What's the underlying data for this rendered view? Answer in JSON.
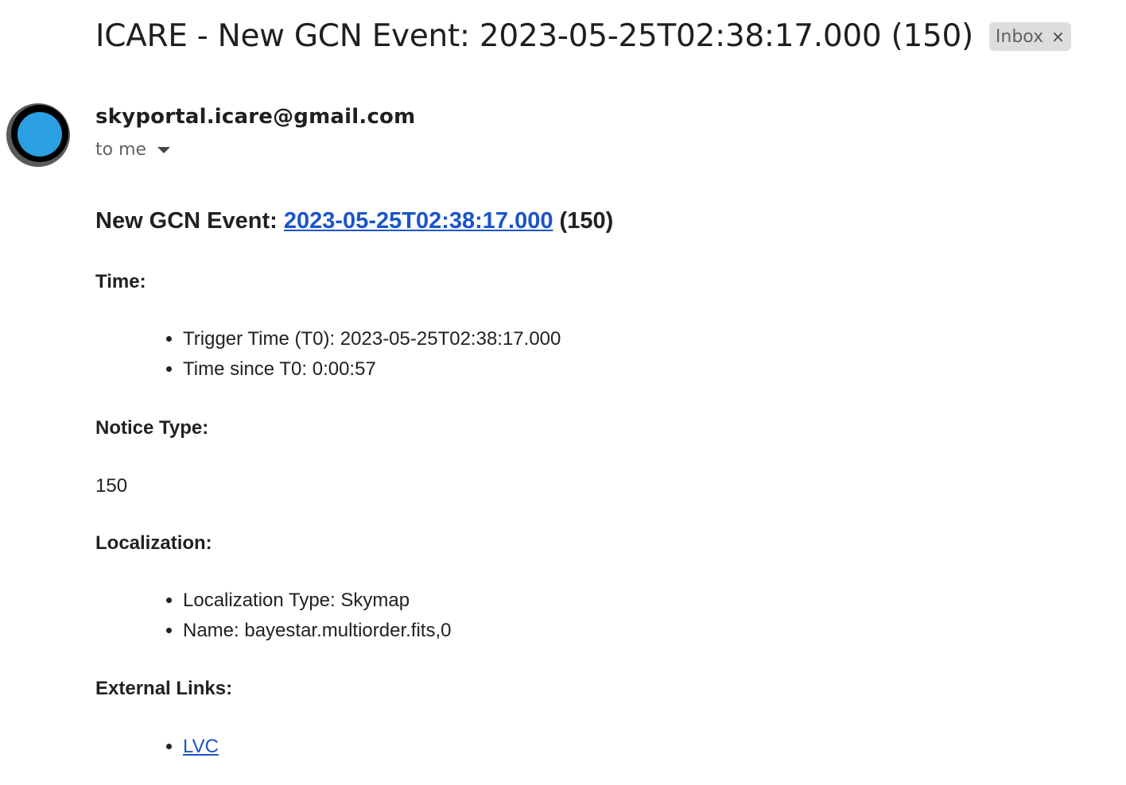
{
  "email": {
    "subject": "ICARE - New GCN Event: 2023-05-25T02:38:17.000 (150)",
    "label_chip": "Inbox",
    "label_remove_icon": "×",
    "sender": "skyportal.icare@gmail.com",
    "recipients": "to me"
  },
  "body": {
    "heading_prefix": "New GCN Event:",
    "heading_link": "2023-05-25T02:38:17.000",
    "heading_suffix": "(150)",
    "time_label": "Time:",
    "time_items": [
      "Trigger Time (T0): 2023-05-25T02:38:17.000",
      "Time since T0: 0:00:57"
    ],
    "notice_label": "Notice Type:",
    "notice_value": "150",
    "localization_label": "Localization:",
    "localization_items": [
      "Localization Type: Skymap",
      "Name: bayestar.multiorder.fits,0"
    ],
    "links_label": "External Links:",
    "links_items": [
      "LVC"
    ]
  },
  "colors": {
    "link": "#1a55c8",
    "avatar": "#2aa0e2",
    "chip_background": "#dddddd"
  }
}
